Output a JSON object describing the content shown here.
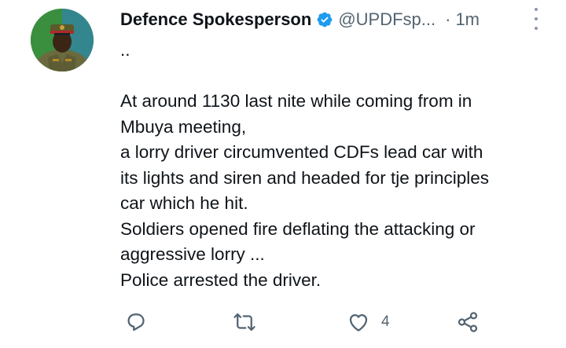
{
  "author": {
    "name": "Defence Spokesperson",
    "handle": "@UPDFsp...",
    "separator": "·",
    "time": "1m"
  },
  "tweet": {
    "lines": [
      "..",
      "",
      "At around 1130 last nite while coming from in",
      "Mbuya meeting,",
      "a lorry driver circumvented CDFs lead car with",
      "its lights and siren and headed for tje principles",
      "car which he hit.",
      "Soldiers opened fire deflating the attacking or",
      "aggressive lorry ...",
      "Police arrested the driver."
    ]
  },
  "actions": {
    "reply": {
      "icon": "reply-icon"
    },
    "retweet": {
      "icon": "retweet-icon"
    },
    "like": {
      "icon": "heart-icon",
      "count": "4"
    },
    "share": {
      "icon": "share-icon"
    }
  },
  "colors": {
    "text": "#0f1419",
    "secondary": "#536471",
    "verified": "#1d9bf0",
    "icon": "#536471"
  }
}
